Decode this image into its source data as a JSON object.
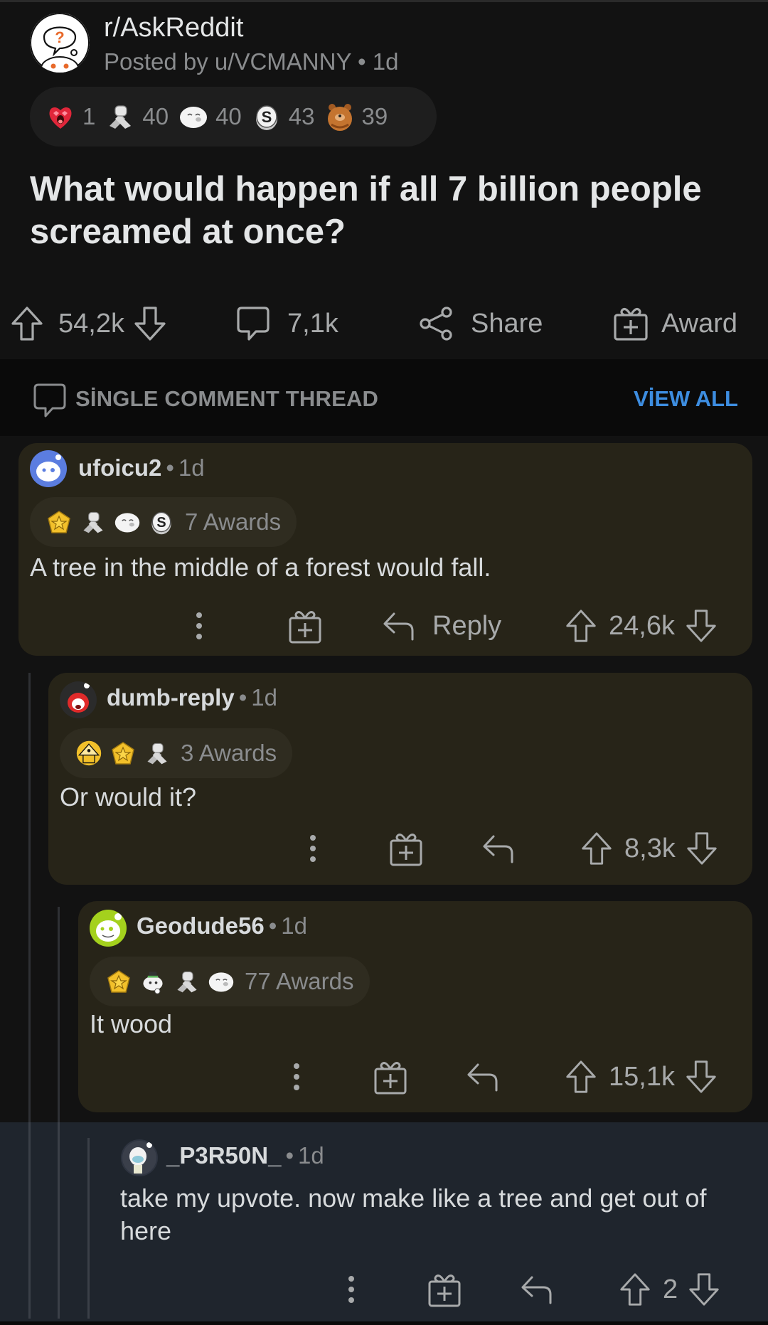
{
  "post": {
    "subreddit": "r/AskReddit",
    "posted_by": "Posted by u/VCMANNY",
    "age": "1d",
    "awards": [
      {
        "icon": "heart-eyes-award-icon",
        "count": "1"
      },
      {
        "icon": "take-my-energy-award-icon",
        "count": "40"
      },
      {
        "icon": "wholesome-seal-award-icon",
        "count": "40"
      },
      {
        "icon": "silver-award-icon",
        "count": "43"
      },
      {
        "icon": "bear-award-icon",
        "count": "39"
      }
    ],
    "title": "What would happen if all 7 billion people screamed at once?",
    "actions": {
      "votes": "54,2k",
      "comments": "7,1k",
      "share": "Share",
      "award": "Award"
    }
  },
  "thread_header": {
    "label": "SİNGLE COMMENT THREAD",
    "view_all": "VİEW ALL"
  },
  "comments": [
    {
      "username": "ufoicu2",
      "age": "1d",
      "awards": [
        "gold-award-icon",
        "take-my-energy-award-icon",
        "wholesome-seal-award-icon",
        "silver-award-icon"
      ],
      "awards_label": "7 Awards",
      "body": "A tree in the middle of a forest would fall.",
      "reply_label": "Reply",
      "votes": "24,6k",
      "avatar_color": "#5b7de0"
    },
    {
      "username": "dumb-reply",
      "age": "1d",
      "awards": [
        "pyramid-award-icon",
        "gold-award-icon",
        "take-my-energy-award-icon"
      ],
      "awards_label": "3 Awards",
      "body": "Or would it?",
      "reply_label": "",
      "votes": "8,3k",
      "avatar_color": "#2b2b2b"
    },
    {
      "username": "Geodude56",
      "age": "1d",
      "awards": [
        "gold-award-icon",
        "snoo-award-icon",
        "take-my-energy-award-icon",
        "wholesome-seal-award-icon"
      ],
      "awards_label": "77 Awards",
      "body": "It wood",
      "reply_label": "",
      "votes": "15,1k",
      "avatar_color": "#a4d11d"
    },
    {
      "username": "_P3R50N_",
      "age": "1d",
      "awards": [],
      "awards_label": "",
      "body": "take my upvote. now make like a tree and get out of here",
      "reply_label": "",
      "votes": "2",
      "avatar_color": "#2e3440"
    }
  ],
  "colors": {
    "background": "#121212",
    "card": "#272418",
    "highlight": "#1f252d",
    "accent": "#3d8de0"
  }
}
